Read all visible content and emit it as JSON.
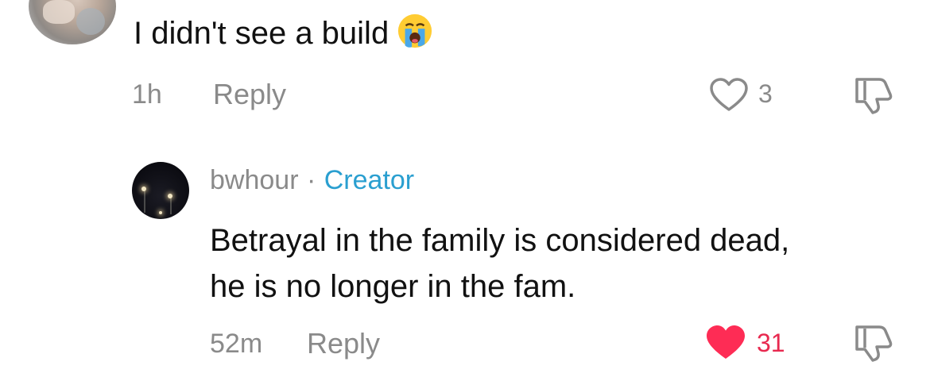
{
  "comments": [
    {
      "text": "I didn't see a build",
      "emoji": "loudly-crying-face",
      "time": "1h",
      "reply_label": "Reply",
      "likes": "3",
      "liked": false
    },
    {
      "username": "bwhour",
      "separator": "·",
      "badge": "Creator",
      "text_line1": "Betrayal in the family is considered dead,",
      "text_line2": "he is no longer in the fam.",
      "time": "52m",
      "reply_label": "Reply",
      "likes": "31",
      "liked": true
    }
  ],
  "colors": {
    "liked_heart": "#fe2c55",
    "creator_badge": "#2a9fd0",
    "meta_gray": "#8a8a8a"
  }
}
